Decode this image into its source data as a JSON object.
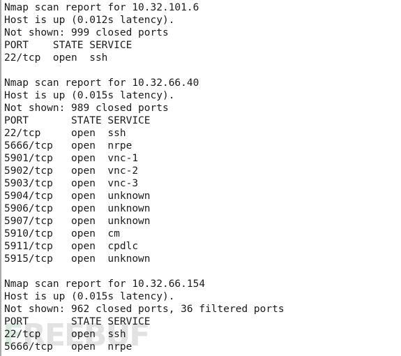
{
  "terminal": {
    "background_color": "#ffffff",
    "text_color": "#1a1a1a",
    "border_color": "#a9a9a9",
    "font_size_px": 14.5,
    "line_height_px": 18
  },
  "watermark": {
    "text": "FREEBUF",
    "first_letter": "F",
    "remaining_letters": "REEBUF",
    "first_letter_color": "#d9ece0",
    "remaining_color": "#e2e2e2"
  },
  "scan": {
    "report_label": "Nmap scan report for",
    "host_up_label": "Host is up",
    "not_shown_label": "Not shown:",
    "columns": [
      "PORT",
      "STATE",
      "SERVICE"
    ],
    "hosts": [
      {
        "ip": "10.32.101.6",
        "latency": "0.012s",
        "host_status_line": "Host is up (0.012s latency).",
        "not_shown_line": "Not shown: 999 closed ports",
        "closed_ports": 999,
        "filtered_ports": 0,
        "header_line": "PORT    STATE SERVICE",
        "ports": [
          {
            "port": "22/tcp",
            "state": "open",
            "service": "ssh",
            "line": "22/tcp  open  ssh"
          }
        ]
      },
      {
        "ip": "10.32.66.40",
        "latency": "0.015s",
        "host_status_line": "Host is up (0.015s latency).",
        "not_shown_line": "Not shown: 989 closed ports",
        "closed_ports": 989,
        "filtered_ports": 0,
        "header_line": "PORT       STATE SERVICE",
        "ports": [
          {
            "port": "22/tcp",
            "state": "open",
            "service": "ssh",
            "line": "22/tcp     open  ssh"
          },
          {
            "port": "5666/tcp",
            "state": "open",
            "service": "nrpe",
            "line": "5666/tcp   open  nrpe"
          },
          {
            "port": "5901/tcp",
            "state": "open",
            "service": "vnc-1",
            "line": "5901/tcp   open  vnc-1"
          },
          {
            "port": "5902/tcp",
            "state": "open",
            "service": "vnc-2",
            "line": "5902/tcp   open  vnc-2"
          },
          {
            "port": "5903/tcp",
            "state": "open",
            "service": "vnc-3",
            "line": "5903/tcp   open  vnc-3"
          },
          {
            "port": "5904/tcp",
            "state": "open",
            "service": "unknown",
            "line": "5904/tcp   open  unknown"
          },
          {
            "port": "5906/tcp",
            "state": "open",
            "service": "unknown",
            "line": "5906/tcp   open  unknown"
          },
          {
            "port": "5907/tcp",
            "state": "open",
            "service": "unknown",
            "line": "5907/tcp   open  unknown"
          },
          {
            "port": "5910/tcp",
            "state": "open",
            "service": "cm",
            "line": "5910/tcp   open  cm"
          },
          {
            "port": "5911/tcp",
            "state": "open",
            "service": "cpdlc",
            "line": "5911/tcp   open  cpdlc"
          },
          {
            "port": "5915/tcp",
            "state": "open",
            "service": "unknown",
            "line": "5915/tcp   open  unknown"
          }
        ]
      },
      {
        "ip": "10.32.66.154",
        "latency": "0.015s",
        "host_status_line": "Host is up (0.015s latency).",
        "not_shown_line": "Not shown: 962 closed ports, 36 filtered ports",
        "closed_ports": 962,
        "filtered_ports": 36,
        "header_line": "PORT       STATE SERVICE",
        "ports": [
          {
            "port": "22/tcp",
            "state": "open",
            "service": "ssh",
            "line": "22/tcp     open  ssh"
          },
          {
            "port": "5666/tcp",
            "state": "open",
            "service": "nrpe",
            "line": "5666/tcp   open  nrpe"
          }
        ]
      }
    ],
    "full_text": "Nmap scan report for 10.32.101.6\nHost is up (0.012s latency).\nNot shown: 999 closed ports\nPORT    STATE SERVICE\n22/tcp  open  ssh\n\nNmap scan report for 10.32.66.40\nHost is up (0.015s latency).\nNot shown: 989 closed ports\nPORT       STATE SERVICE\n22/tcp     open  ssh\n5666/tcp   open  nrpe\n5901/tcp   open  vnc-1\n5902/tcp   open  vnc-2\n5903/tcp   open  vnc-3\n5904/tcp   open  unknown\n5906/tcp   open  unknown\n5907/tcp   open  unknown\n5910/tcp   open  cm\n5911/tcp   open  cpdlc\n5915/tcp   open  unknown\n\nNmap scan report for 10.32.66.154\nHost is up (0.015s latency).\nNot shown: 962 closed ports, 36 filtered ports\nPORT       STATE SERVICE\n22/tcp     open  ssh\n5666/tcp   open  nrpe"
  }
}
